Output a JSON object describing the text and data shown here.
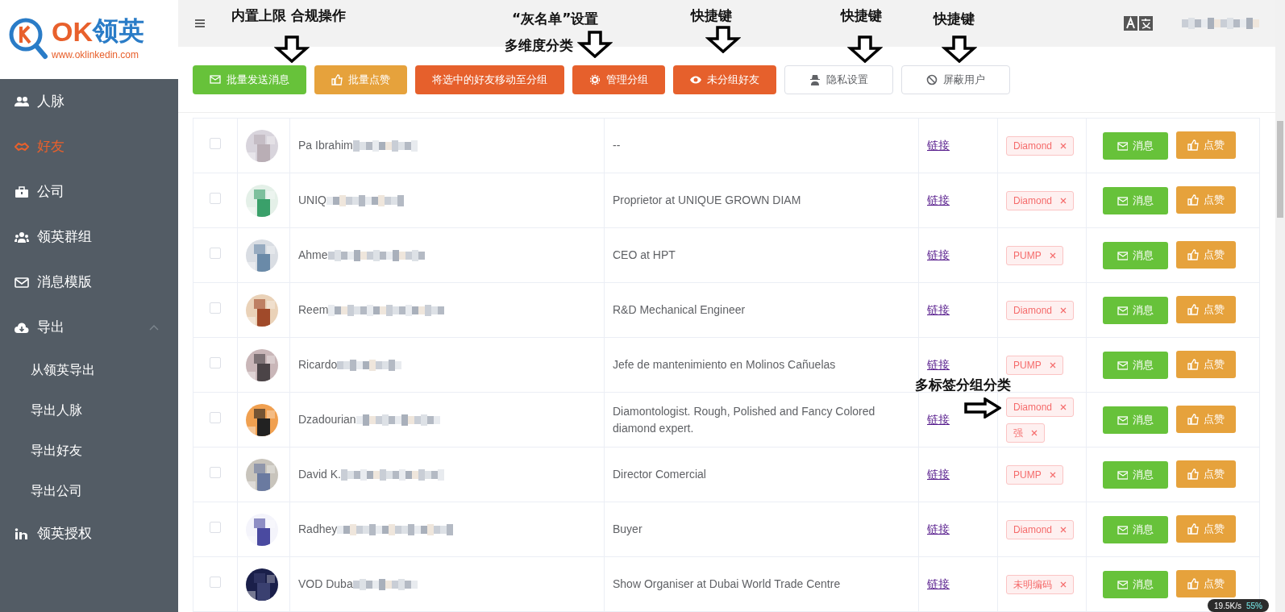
{
  "logo": {
    "brand_latin": "OK",
    "brand_cjk": "领英",
    "url": "www.oklinkedin.com"
  },
  "sidebar": {
    "items": [
      {
        "label": "人脉",
        "selected": false
      },
      {
        "label": "好友",
        "selected": true
      },
      {
        "label": "公司",
        "selected": false
      },
      {
        "label": "领英群组",
        "selected": false
      },
      {
        "label": "消息模版",
        "selected": false
      },
      {
        "label": "导出",
        "selected": false,
        "expanded": true,
        "children": [
          {
            "label": "从领英导出",
            "selected": false
          },
          {
            "label": "导出人脉",
            "selected": false
          },
          {
            "label": "导出好友",
            "selected": false
          },
          {
            "label": "导出公司",
            "selected": false
          }
        ]
      },
      {
        "label": "领英授权",
        "selected": false
      }
    ]
  },
  "toolbar": {
    "buttons": [
      {
        "label": "批量发送消息"
      },
      {
        "label": "批量点赞"
      },
      {
        "label": "将选中的好友移动至分组"
      },
      {
        "label": "管理分组"
      },
      {
        "label": "未分组好友"
      },
      {
        "label": "隐私设置"
      },
      {
        "label": "屏蔽用户"
      }
    ]
  },
  "table": {
    "rows": [
      {
        "checked": false,
        "name": "Pa Ibrahim",
        "title": "--",
        "link": "链接",
        "tags": [
          "Diamond"
        ],
        "actions": [
          "消息",
          "点赞"
        ]
      },
      {
        "checked": false,
        "name": "UNIQ",
        "title": "Proprietor at UNIQUE GROWN DIAM",
        "link": "链接",
        "tags": [
          "Diamond"
        ],
        "actions": [
          "消息",
          "点赞"
        ]
      },
      {
        "checked": false,
        "name": "Ahme",
        "title": "CEO at HPT",
        "link": "链接",
        "tags": [
          "PUMP"
        ],
        "actions": [
          "消息",
          "点赞"
        ]
      },
      {
        "checked": false,
        "name": "Reem",
        "title": "R&D Mechanical Engineer",
        "link": "链接",
        "tags": [
          "Diamond"
        ],
        "actions": [
          "消息",
          "点赞"
        ]
      },
      {
        "checked": false,
        "name": "Ricardo",
        "title": "Jefe de mantenimiento en Molinos Cañuelas",
        "link": "链接",
        "tags": [
          "PUMP"
        ],
        "actions": [
          "消息",
          "点赞"
        ]
      },
      {
        "checked": false,
        "name": "Dzadourian",
        "title": "Diamontologist. Rough, Polished and Fancy Colored diamond expert.",
        "link": "链接",
        "tags": [
          "Diamond",
          "强"
        ],
        "actions": [
          "消息",
          "点赞"
        ]
      },
      {
        "checked": false,
        "name": "David K.",
        "title": "Director Comercial",
        "link": "链接",
        "tags": [
          "PUMP"
        ],
        "actions": [
          "消息",
          "点赞"
        ]
      },
      {
        "checked": false,
        "name": "Radhey",
        "title": "Buyer",
        "link": "链接",
        "tags": [
          "Diamond"
        ],
        "actions": [
          "消息",
          "点赞"
        ]
      },
      {
        "checked": false,
        "name": "VOD Duba",
        "title": "Show Organiser at Dubai World Trade Centre",
        "link": "链接",
        "tags": [
          "未明编码"
        ],
        "actions": [
          "消息",
          "点赞"
        ]
      }
    ]
  },
  "annotations": [
    {
      "text": "内置上限 合规操作",
      "kind": "down"
    },
    {
      "text": "“灰名单”设置",
      "kind": "plain"
    },
    {
      "text": "多维度分类",
      "kind": "down"
    },
    {
      "text": "快捷键",
      "kind": "down"
    },
    {
      "text": "快捷键",
      "kind": "down"
    },
    {
      "text": "快捷键",
      "kind": "down"
    },
    {
      "text": "多标签分组分类",
      "kind": "right"
    }
  ],
  "speed_widget": {
    "rate": "19.5K/s",
    "percent": "55%"
  }
}
